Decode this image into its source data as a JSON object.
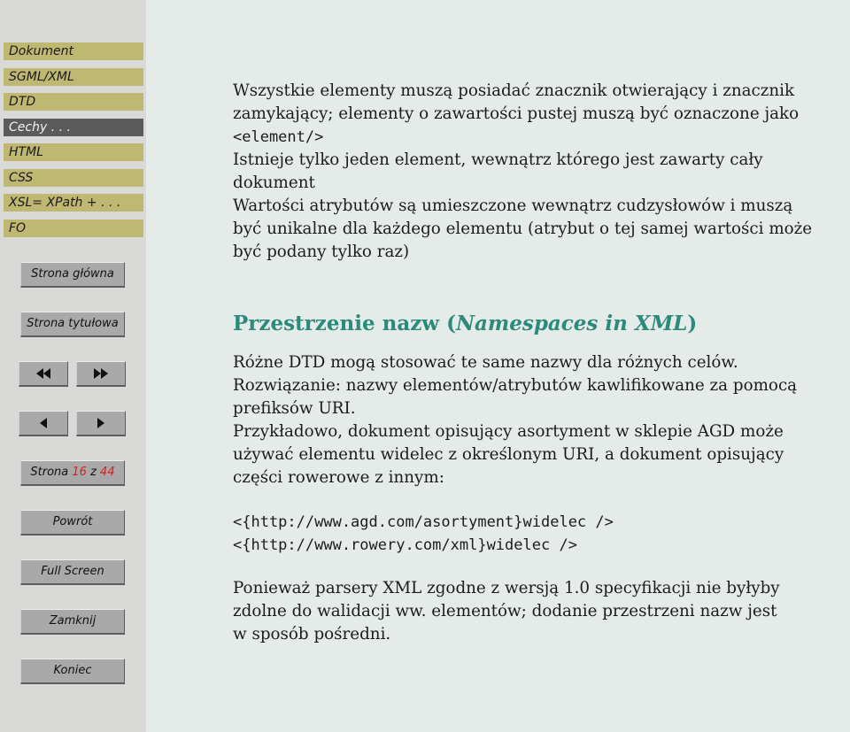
{
  "sidebar": {
    "menu": [
      {
        "label": "Dokument",
        "active": false
      },
      {
        "label": "SGML/XML",
        "active": false
      },
      {
        "label": "DTD",
        "active": false
      },
      {
        "label": "Cechy . . .",
        "active": true
      },
      {
        "label": "HTML",
        "active": false
      },
      {
        "label": "CSS",
        "active": false
      },
      {
        "label": "XSL= XPath + . . .",
        "active": false
      },
      {
        "label": "FO",
        "active": false
      }
    ],
    "buttons": {
      "home": "Strona główna",
      "title_page": "Strona tytułowa",
      "first_icon": "double-left-arrow-icon",
      "last_icon": "double-right-arrow-icon",
      "prev_icon": "left-arrow-icon",
      "next_icon": "right-arrow-icon",
      "page_prefix": "Strona",
      "page_current": "16",
      "page_sep": "z",
      "page_total": "44",
      "back": "Powrót",
      "fullscreen": "Full Screen",
      "close": "Zamknij",
      "end": "Koniec"
    },
    "colors": {
      "menu_bg": "#bfb872",
      "menu_active_bg": "#5b5b5b",
      "button_bg": "#a9a9a9",
      "page_number": "#d42020"
    }
  },
  "content": {
    "para1": [
      "Wszystkie elementy muszą posiadać znacznik otwierający i znacznik",
      "zamykający; elementy o zawartości pustej muszą być oznaczone jako"
    ],
    "para1_code": "<element/>",
    "para2": [
      "Istnieje tylko jeden element, wewnątrz którego jest zawarty cały",
      "dokument"
    ],
    "para3": [
      "Wartości atrybutów są umieszczone wewnątrz cudzysłowów i muszą",
      "być unikalne dla każdego elementu (atrybut o tej samej wartości może",
      "być podany tylko raz)"
    ],
    "heading": {
      "prefix": "Przestrzenie nazw (",
      "italic": "Namespaces in XML",
      "suffix": ")",
      "color": "#2b8a7a"
    },
    "para4": [
      "Różne DTD mogą stosować te same nazwy dla różnych celów.",
      "Rozwiązanie: nazwy elementów/atrybutów kawlifikowane za pomocą",
      "prefiksów URI.",
      "Przykładowo, dokument opisujący asortyment w sklepie AGD może",
      "używać elementu widelec z określonym URI, a dokument opisujący",
      "części rowerowe z innym:"
    ],
    "code": [
      "<{http://www.agd.com/asortyment}widelec />",
      "<{http://www.rowery.com/xml}widelec />"
    ],
    "para5": [
      "Ponieważ parsery XML zgodne z wersją 1.0 specyfikacji nie byłyby",
      "zdolne do walidacji ww. elementów; dodanie przestrzeni nazw jest",
      "w sposób pośredni."
    ]
  }
}
